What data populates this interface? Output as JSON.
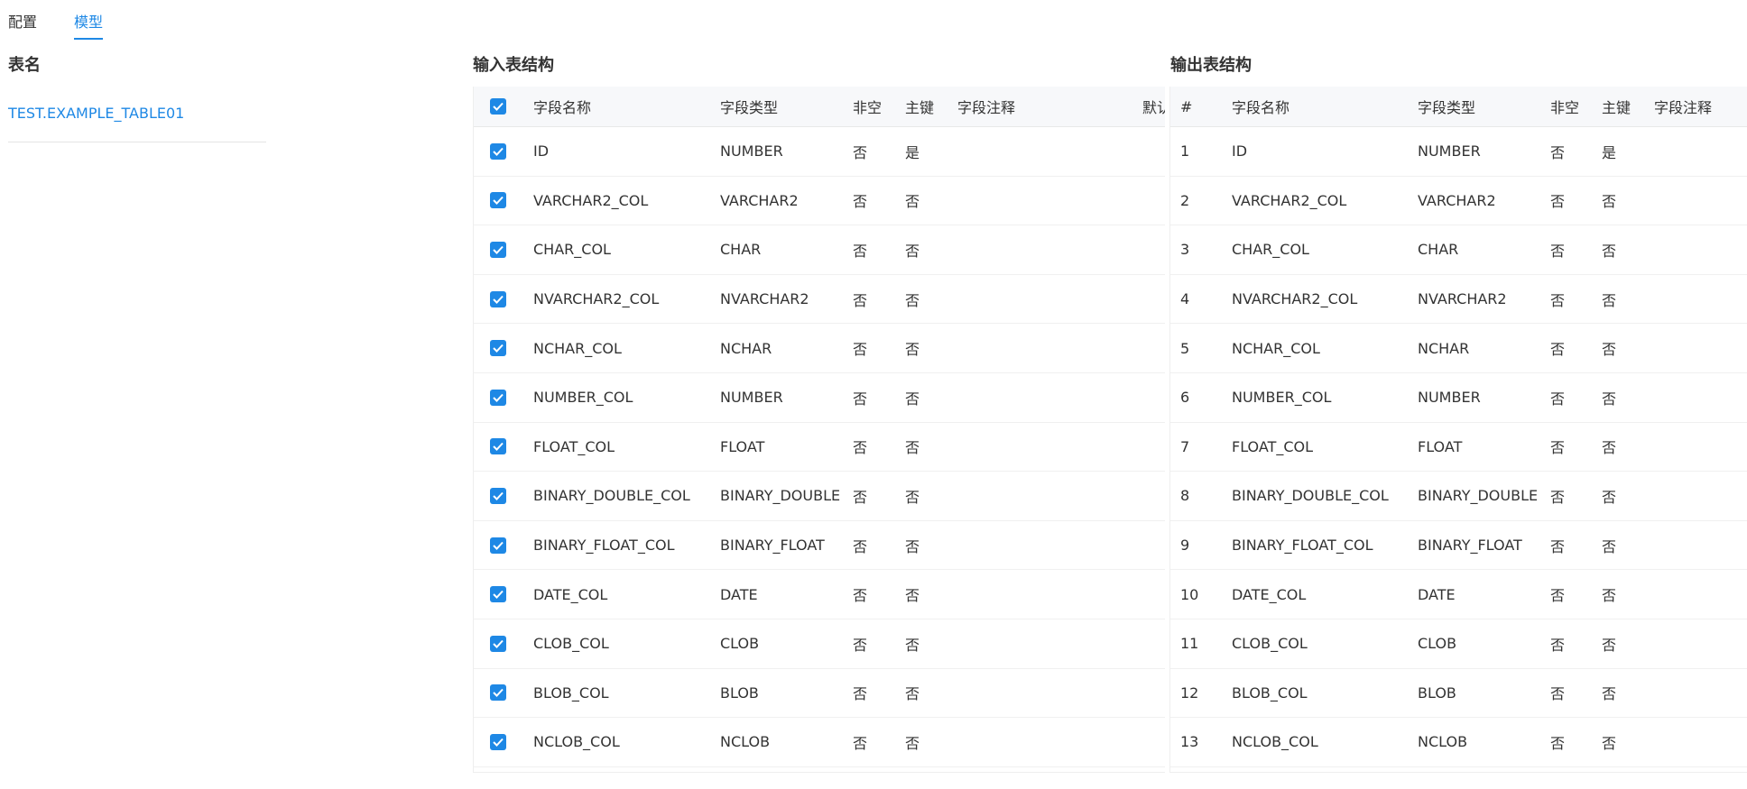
{
  "tabs": [
    {
      "label": "配置",
      "active": false
    },
    {
      "label": "模型",
      "active": true
    }
  ],
  "left": {
    "title": "表名",
    "table_name": "TEST.EXAMPLE_TABLE01"
  },
  "input_table": {
    "title": "输入表结构",
    "headers": {
      "name": "字段名称",
      "type": "字段类型",
      "not_null": "非空",
      "primary_key": "主键",
      "comment": "字段注释",
      "default": "默认值"
    },
    "rows": [
      {
        "name": "ID",
        "type": "NUMBER",
        "not_null": "否",
        "primary_key": "是",
        "checked": true
      },
      {
        "name": "VARCHAR2_COL",
        "type": "VARCHAR2",
        "not_null": "否",
        "primary_key": "否",
        "checked": true
      },
      {
        "name": "CHAR_COL",
        "type": "CHAR",
        "not_null": "否",
        "primary_key": "否",
        "checked": true
      },
      {
        "name": "NVARCHAR2_COL",
        "type": "NVARCHAR2",
        "not_null": "否",
        "primary_key": "否",
        "checked": true
      },
      {
        "name": "NCHAR_COL",
        "type": "NCHAR",
        "not_null": "否",
        "primary_key": "否",
        "checked": true
      },
      {
        "name": "NUMBER_COL",
        "type": "NUMBER",
        "not_null": "否",
        "primary_key": "否",
        "checked": true
      },
      {
        "name": "FLOAT_COL",
        "type": "FLOAT",
        "not_null": "否",
        "primary_key": "否",
        "checked": true
      },
      {
        "name": "BINARY_DOUBLE_COL",
        "type": "BINARY_DOUBLE",
        "not_null": "否",
        "primary_key": "否",
        "checked": true
      },
      {
        "name": "BINARY_FLOAT_COL",
        "type": "BINARY_FLOAT",
        "not_null": "否",
        "primary_key": "否",
        "checked": true
      },
      {
        "name": "DATE_COL",
        "type": "DATE",
        "not_null": "否",
        "primary_key": "否",
        "checked": true
      },
      {
        "name": "CLOB_COL",
        "type": "CLOB",
        "not_null": "否",
        "primary_key": "否",
        "checked": true
      },
      {
        "name": "BLOB_COL",
        "type": "BLOB",
        "not_null": "否",
        "primary_key": "否",
        "checked": true
      },
      {
        "name": "NCLOB_COL",
        "type": "NCLOB",
        "not_null": "否",
        "primary_key": "否",
        "checked": true
      }
    ]
  },
  "output_table": {
    "title": "输出表结构",
    "headers": {
      "index": "#",
      "name": "字段名称",
      "type": "字段类型",
      "not_null": "非空",
      "primary_key": "主键",
      "comment": "字段注释"
    },
    "rows": [
      {
        "index": "1",
        "name": "ID",
        "type": "NUMBER",
        "not_null": "否",
        "primary_key": "是"
      },
      {
        "index": "2",
        "name": "VARCHAR2_COL",
        "type": "VARCHAR2",
        "not_null": "否",
        "primary_key": "否"
      },
      {
        "index": "3",
        "name": "CHAR_COL",
        "type": "CHAR",
        "not_null": "否",
        "primary_key": "否"
      },
      {
        "index": "4",
        "name": "NVARCHAR2_COL",
        "type": "NVARCHAR2",
        "not_null": "否",
        "primary_key": "否"
      },
      {
        "index": "5",
        "name": "NCHAR_COL",
        "type": "NCHAR",
        "not_null": "否",
        "primary_key": "否"
      },
      {
        "index": "6",
        "name": "NUMBER_COL",
        "type": "NUMBER",
        "not_null": "否",
        "primary_key": "否"
      },
      {
        "index": "7",
        "name": "FLOAT_COL",
        "type": "FLOAT",
        "not_null": "否",
        "primary_key": "否"
      },
      {
        "index": "8",
        "name": "BINARY_DOUBLE_COL",
        "type": "BINARY_DOUBLE",
        "not_null": "否",
        "primary_key": "否"
      },
      {
        "index": "9",
        "name": "BINARY_FLOAT_COL",
        "type": "BINARY_FLOAT",
        "not_null": "否",
        "primary_key": "否"
      },
      {
        "index": "10",
        "name": "DATE_COL",
        "type": "DATE",
        "not_null": "否",
        "primary_key": "否"
      },
      {
        "index": "11",
        "name": "CLOB_COL",
        "type": "CLOB",
        "not_null": "否",
        "primary_key": "否"
      },
      {
        "index": "12",
        "name": "BLOB_COL",
        "type": "BLOB",
        "not_null": "否",
        "primary_key": "否"
      },
      {
        "index": "13",
        "name": "NCLOB_COL",
        "type": "NCLOB",
        "not_null": "否",
        "primary_key": "否"
      }
    ]
  },
  "colors": {
    "accent": "#1e88e5",
    "text": "#333333",
    "header_bg": "#f7f8fa"
  }
}
